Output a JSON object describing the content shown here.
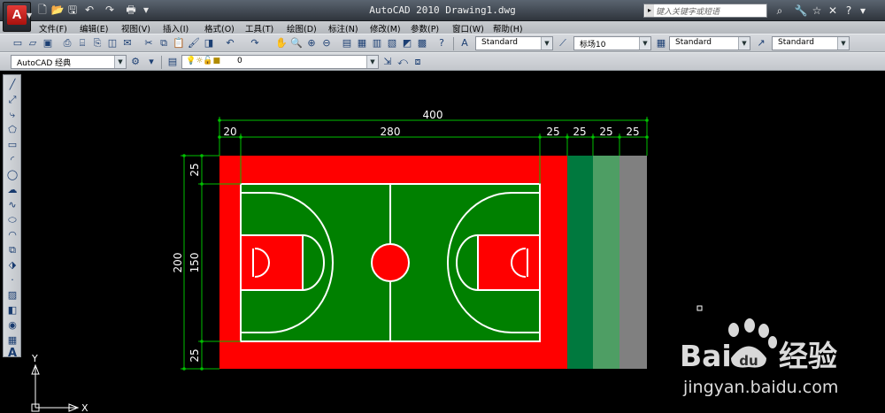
{
  "window": {
    "title": "AutoCAD 2010   Drawing1.dwg"
  },
  "search": {
    "placeholder": "键入关键字或短语"
  },
  "menu": [
    "文件(F)",
    "编辑(E)",
    "视图(V)",
    "插入(I)",
    "格式(O)",
    "工具(T)",
    "绘图(D)",
    "标注(N)",
    "修改(M)",
    "参数(P)",
    "窗口(W)",
    "帮助(H)"
  ],
  "toolbar": {
    "text_style": "Standard",
    "dim_style": "标场10",
    "table_style": "Standard",
    "mleader_style": "Standard",
    "workspace": "AutoCAD 经典",
    "layer": "0"
  },
  "drawing": {
    "dims_top": {
      "total": "400",
      "segments": [
        "20",
        "280",
        "25",
        "25",
        "25",
        "25"
      ]
    },
    "dims_left": {
      "total": "200",
      "segments": [
        "25",
        "150",
        "25"
      ]
    },
    "colors": {
      "red": "#ff0000",
      "green": "#008000",
      "teal": "#00793e",
      "lightgreen": "#4e9e64",
      "gray": "#808080",
      "dim": "#00c000"
    }
  },
  "ucs": {
    "x_label": "X",
    "y_label": "Y"
  },
  "watermark": {
    "brand": "Baidu经验",
    "url": "jingyan.baidu.com"
  }
}
